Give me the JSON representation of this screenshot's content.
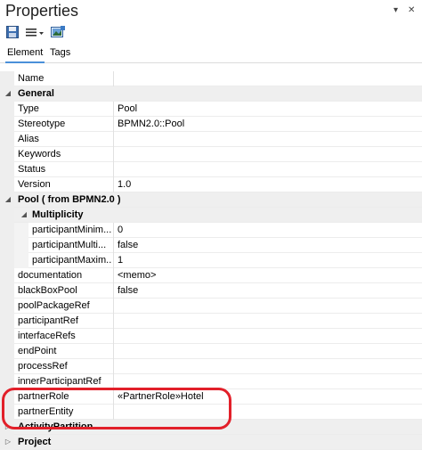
{
  "panel": {
    "title": "Properties",
    "pin_glyph": "▾",
    "close_glyph": "✕"
  },
  "toolbar": {
    "buttons": [
      {
        "icon": "save-icon"
      },
      {
        "icon": "list-menu-icon"
      },
      {
        "icon": "image-icon"
      }
    ]
  },
  "tabs": [
    {
      "label": "Element",
      "active": true
    },
    {
      "label": "Tags",
      "active": false
    }
  ],
  "rows": [
    {
      "kind": "prop",
      "name": "Name",
      "value": "",
      "level": 1
    },
    {
      "kind": "group",
      "name": "General",
      "level": 0,
      "toggle": "◢"
    },
    {
      "kind": "prop",
      "name": "Type",
      "value": "Pool",
      "level": 1
    },
    {
      "kind": "prop",
      "name": "Stereotype",
      "value": "BPMN2.0::Pool",
      "level": 1
    },
    {
      "kind": "prop",
      "name": "Alias",
      "value": "",
      "level": 1
    },
    {
      "kind": "prop",
      "name": "Keywords",
      "value": "",
      "level": 1
    },
    {
      "kind": "prop",
      "name": "Status",
      "value": "",
      "level": 1
    },
    {
      "kind": "prop",
      "name": "Version",
      "value": "1.0",
      "level": 1
    },
    {
      "kind": "group",
      "name": "Pool  ( from BPMN2.0 )",
      "level": 0,
      "toggle": "◢"
    },
    {
      "kind": "group",
      "name": "Multiplicity",
      "level": 1,
      "toggle": "◢"
    },
    {
      "kind": "prop",
      "name": "participantMinim...",
      "value": "0",
      "level": 2
    },
    {
      "kind": "prop",
      "name": "participantMulti...",
      "value": "false",
      "level": 2
    },
    {
      "kind": "prop",
      "name": "participantMaxim...",
      "value": "1",
      "level": 2
    },
    {
      "kind": "prop",
      "name": "documentation",
      "value": "<memo>",
      "level": 1
    },
    {
      "kind": "prop",
      "name": "blackBoxPool",
      "value": "false",
      "level": 1
    },
    {
      "kind": "prop",
      "name": "poolPackageRef",
      "value": "",
      "level": 1
    },
    {
      "kind": "prop",
      "name": "participantRef",
      "value": "",
      "level": 1
    },
    {
      "kind": "prop",
      "name": "interfaceRefs",
      "value": "",
      "level": 1
    },
    {
      "kind": "prop",
      "name": "endPoint",
      "value": "",
      "level": 1
    },
    {
      "kind": "prop",
      "name": "processRef",
      "value": "",
      "level": 1
    },
    {
      "kind": "prop",
      "name": "innerParticipantRef",
      "value": "",
      "level": 1
    },
    {
      "kind": "prop",
      "name": "partnerRole",
      "value": "«PartnerRole»Hotel",
      "level": 1
    },
    {
      "kind": "prop",
      "name": "partnerEntity",
      "value": "",
      "level": 1
    },
    {
      "kind": "group",
      "name": "ActivityPartition",
      "level": 0,
      "toggle": "▷"
    },
    {
      "kind": "group",
      "name": "Project",
      "level": 0,
      "toggle": "▷"
    }
  ],
  "colors": {
    "highlight": "#e2202a",
    "tab_underline": "#4a90d9"
  }
}
